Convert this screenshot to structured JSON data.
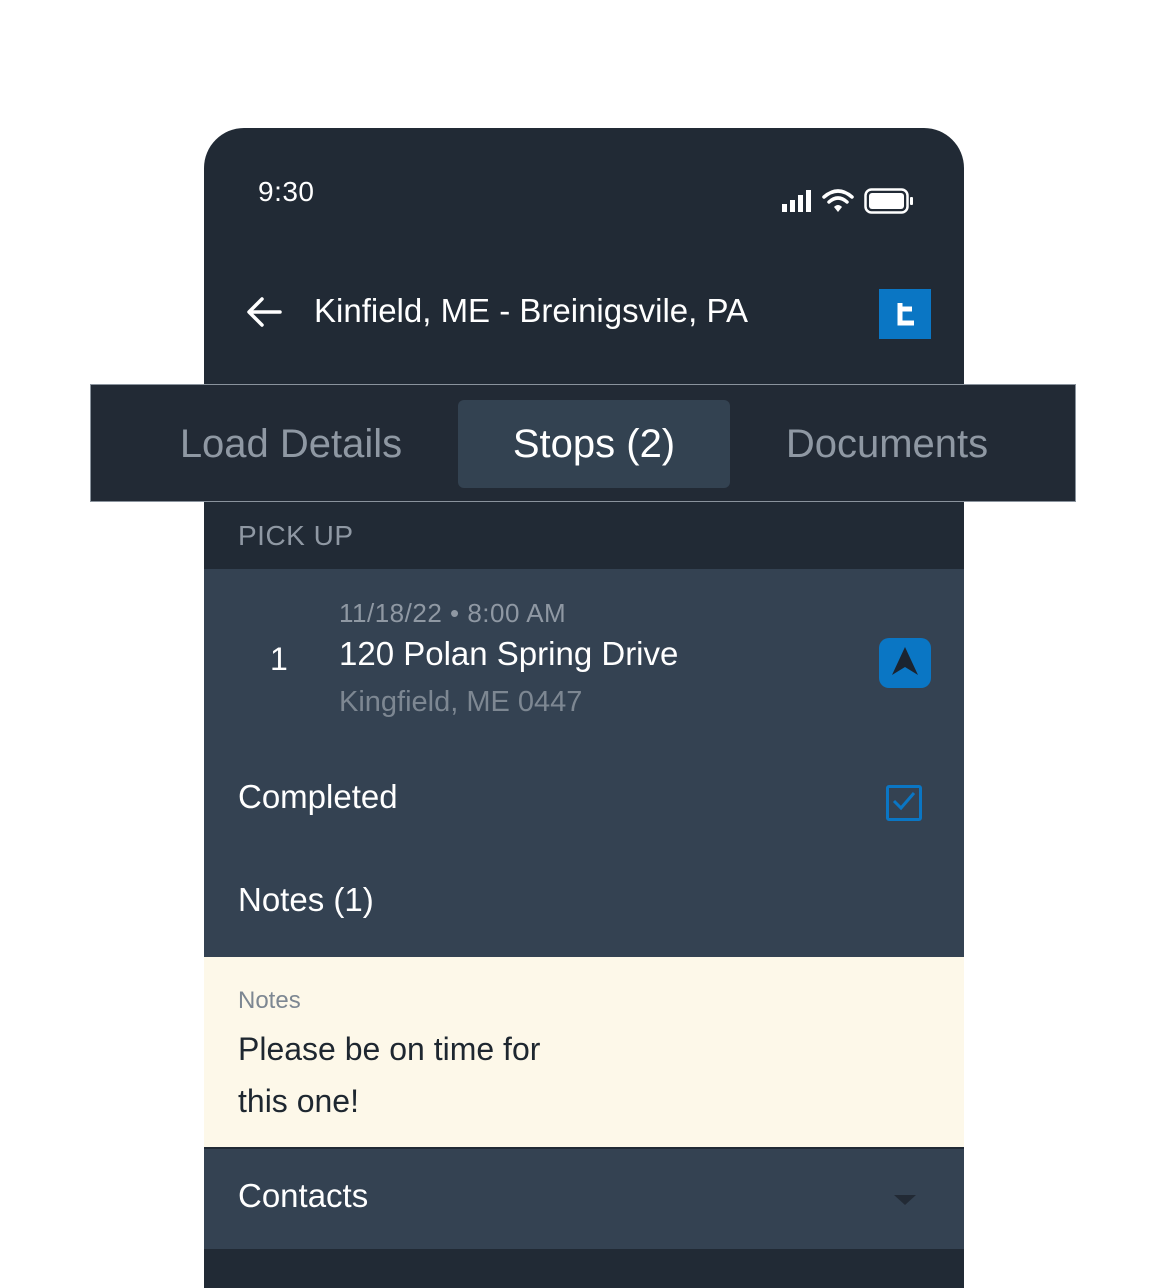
{
  "status_bar": {
    "time": "9:30"
  },
  "header": {
    "title": "Kinfield, ME - Breinigsvile, PA",
    "back_icon": "arrow-left-icon",
    "logo_letter": "t"
  },
  "tabs": [
    {
      "label": "Load Details",
      "active": false
    },
    {
      "label": "Stops (2)",
      "active": true
    },
    {
      "label": "Documents",
      "active": false
    }
  ],
  "section": {
    "label": "PICK UP"
  },
  "stop": {
    "number": "1",
    "datetime": "11/18/22 • 8:00 AM",
    "address": "120 Polan Spring Drive",
    "city": "Kingfield, ME 0447",
    "navigate_icon": "navigation-arrow-icon"
  },
  "completed": {
    "label": "Completed",
    "checked": true
  },
  "notes_row": {
    "label": "Notes (1)"
  },
  "notes": {
    "caption": "Notes",
    "text": "Please be on time for this one!"
  },
  "contacts": {
    "label": "Contacts",
    "icon": "caret-down-icon"
  },
  "colors": {
    "background_dark": "#212a35",
    "card": "#344252",
    "accent": "#0a76c4",
    "notes_bg": "#fdf8e9"
  }
}
